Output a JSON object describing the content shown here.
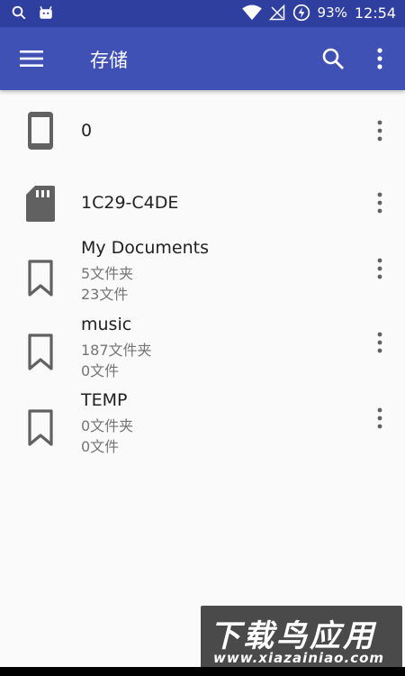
{
  "status_bar": {
    "battery": "93%",
    "time": "12:54"
  },
  "appbar": {
    "title": "存储"
  },
  "items": [
    {
      "icon": "phone-icon",
      "title": "0"
    },
    {
      "icon": "sd-card-icon",
      "title": "1C29-C4DE"
    },
    {
      "icon": "bookmark-icon",
      "title": "My Documents",
      "folders": "5文件夹",
      "files": "23文件"
    },
    {
      "icon": "bookmark-icon",
      "title": "music",
      "folders": "187文件夹",
      "files": "0文件"
    },
    {
      "icon": "bookmark-icon",
      "title": "TEMP",
      "folders": "0文件夹",
      "files": "0文件"
    }
  ],
  "watermark": {
    "text": "下载鸟应用",
    "url": "www.xiazainiao.com"
  },
  "colors": {
    "status_bar": "#2f3f9f",
    "app_bar": "#3f51b5",
    "background": "#fafafa",
    "icon": "#616161"
  }
}
